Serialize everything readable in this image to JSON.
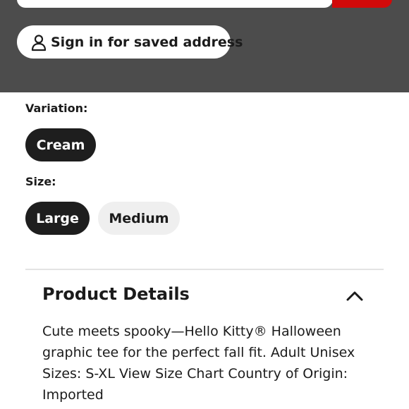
{
  "header": {
    "signin_label": "Sign in for saved address",
    "signin_icon": "user-icon",
    "bg_color": "#4c4c4c",
    "accent_color": "#d10a0a"
  },
  "variation": {
    "label": "Variation:",
    "options": [
      {
        "label": "Cream",
        "selected": true
      }
    ]
  },
  "size": {
    "label": "Size:",
    "options": [
      {
        "label": "Large",
        "selected": true
      },
      {
        "label": "Medium",
        "selected": false
      }
    ]
  },
  "product_details": {
    "title": "Product Details",
    "toggle_icon": "chevron-up-icon",
    "expanded": true,
    "body": "Cute meets spooky—Hello Kitty® Halloween graphic tee for the perfect fall fit. Adult Unisex Sizes: S-XL View Size Chart Country of Origin: Imported"
  }
}
